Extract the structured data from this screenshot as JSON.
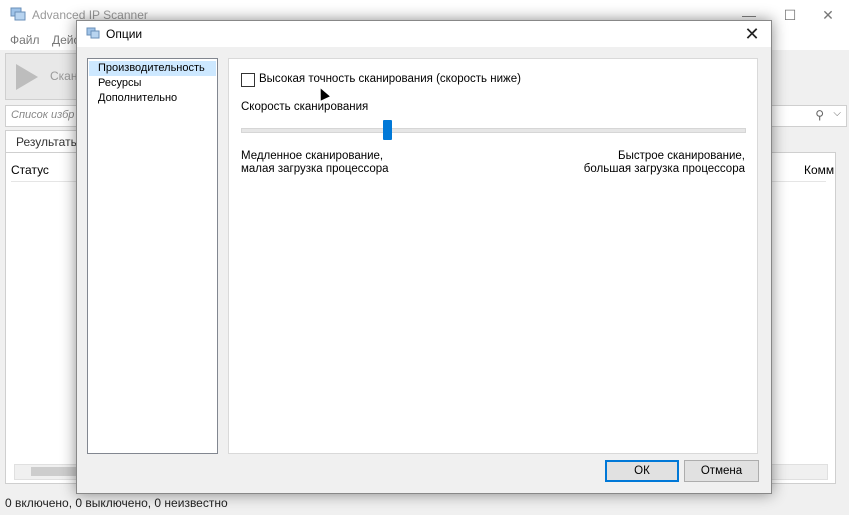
{
  "main": {
    "title": "Advanced IP Scanner",
    "menu": [
      "Файл",
      "Дейс"
    ],
    "scan_label": "Скан",
    "search_placeholder": "Список избр",
    "results_tab": "Результать",
    "columns": {
      "status": "Статус",
      "comment": "Комм"
    },
    "status_text": "0 включено, 0 выключено, 0 неизвестно",
    "window_controls": {
      "minimize": "—",
      "maximize": "☐",
      "close": "✕"
    }
  },
  "dialog": {
    "title": "Опции",
    "close_glyph": "✕",
    "categories": [
      "Производительность",
      "Ресурсы",
      "Дополнительно"
    ],
    "selected_category": 0,
    "performance": {
      "high_accuracy_label": "Высокая точность сканирования (скорость ниже)",
      "high_accuracy_checked": false,
      "speed_label": "Скорость сканирования",
      "speed_value_fraction": 0.3,
      "slow_label": "Медленное сканирование,\nмалая загрузка процессора",
      "fast_label": "Быстрое сканирование,\nбольшая загрузка процессора"
    },
    "buttons": {
      "ok": "ОК",
      "cancel": "Отмена"
    }
  },
  "colors": {
    "accent": "#0078d7",
    "selection": "#cde8ff"
  },
  "icons": {
    "app": "network-computer-icon",
    "search": "search-icon",
    "dropdown": "chevron-down-icon"
  }
}
